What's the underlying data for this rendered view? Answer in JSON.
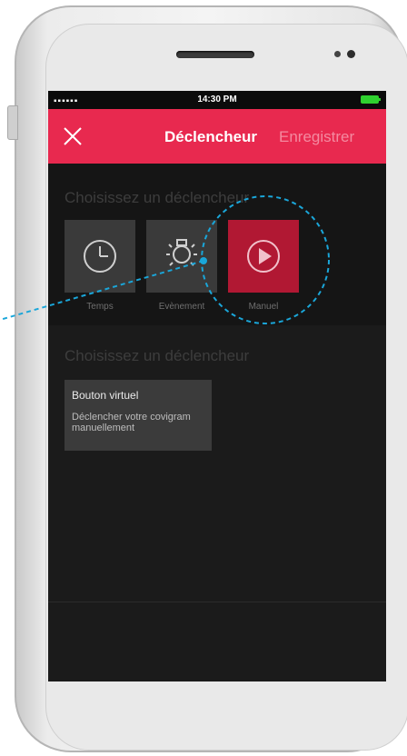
{
  "status_bar": {
    "signal": "▪▪▪▪▪▪",
    "time": "14:30 PM",
    "battery_icon": "battery-full-icon",
    "battery_color": "#2fd12f"
  },
  "nav": {
    "close_icon": "close-icon",
    "title": "Déclencheur",
    "save_label": "Enregistrer",
    "color": "#e8294f"
  },
  "trigger_section": {
    "title": "Choisissez un déclencheur",
    "options": [
      {
        "label": "Temps",
        "icon": "clock-icon"
      },
      {
        "label": "Evènement",
        "icon": "lightbulb-icon"
      },
      {
        "label": "Manuel",
        "icon": "play-icon",
        "selected": true,
        "color": "#b11833"
      }
    ]
  },
  "second_section": {
    "title": "Choisissez un déclencheur",
    "card": {
      "title": "Bouton virtuel",
      "description": "Déclencher votre covigram manuellement"
    }
  },
  "annotation": {
    "color": "#1aa6d9"
  }
}
